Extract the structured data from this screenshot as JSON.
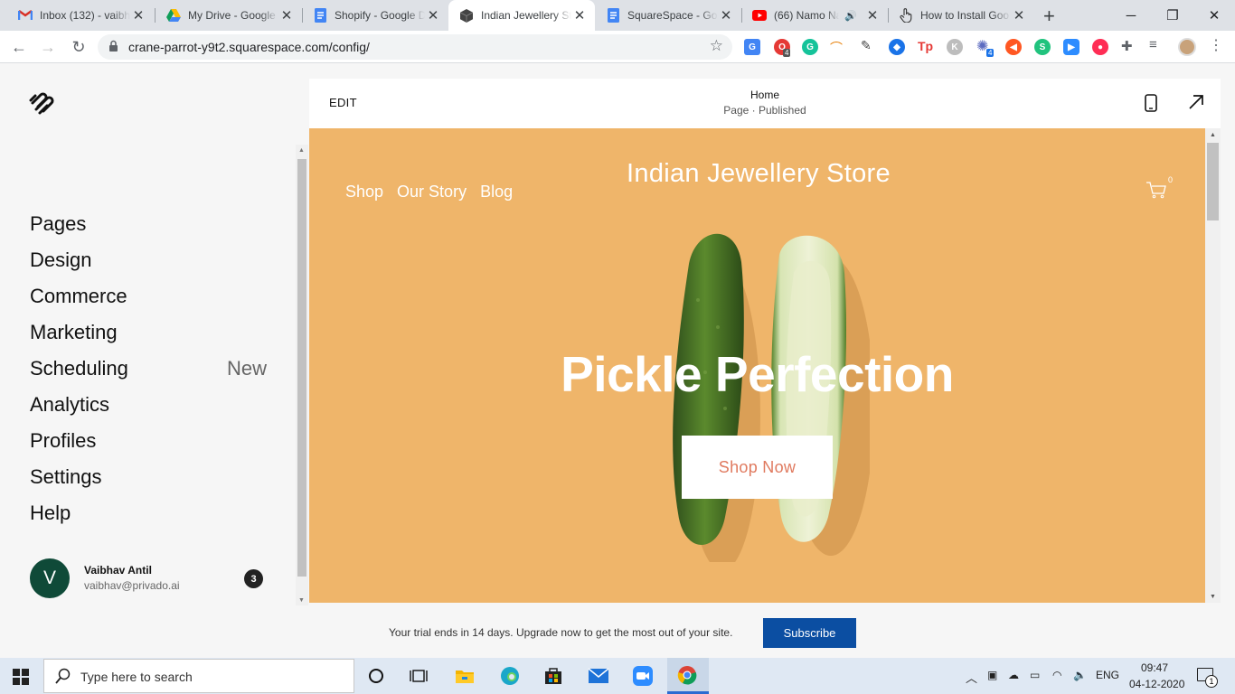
{
  "browser": {
    "tabs": [
      {
        "title": "Inbox (132) - vaibh",
        "icon": "gmail-icon",
        "color": "#d93025"
      },
      {
        "title": "My Drive - Google",
        "icon": "drive-icon",
        "color": "#1a73e8"
      },
      {
        "title": "Shopify - Google D",
        "icon": "docs-icon",
        "color": "#4285f4"
      },
      {
        "title": "Indian Jewellery St",
        "icon": "squarespace-cube-icon",
        "color": "#333333",
        "active": true
      },
      {
        "title": "SquareSpace - Goo",
        "icon": "docs-icon",
        "color": "#4285f4"
      },
      {
        "title": "(66) Namo Na",
        "icon": "youtube-icon",
        "color": "#ff0000"
      },
      {
        "title": "How to Install Goo",
        "icon": "hand-cursor-icon",
        "color": "#333333"
      }
    ],
    "url": "crane-parrot-y9t2.squarespace.com/config/",
    "ext_badges": {
      "opera": "4",
      "puzzle": "4"
    }
  },
  "sidebar": {
    "items": [
      {
        "label": "Pages"
      },
      {
        "label": "Design"
      },
      {
        "label": "Commerce"
      },
      {
        "label": "Marketing"
      },
      {
        "label": "Scheduling",
        "badge": "New"
      },
      {
        "label": "Analytics"
      },
      {
        "label": "Profiles"
      },
      {
        "label": "Settings"
      },
      {
        "label": "Help"
      }
    ],
    "user": {
      "initial": "V",
      "name": "Vaibhav Antil",
      "email": "vaibhav@privado.ai",
      "notifications": "3"
    }
  },
  "preview": {
    "edit_label": "EDIT",
    "page_title": "Home",
    "page_status": "Page · Published",
    "site": {
      "nav": [
        "Shop",
        "Our Story",
        "Blog"
      ],
      "title": "Indian Jewellery Store",
      "cart_count": "0",
      "headline": "Pickle Perfection",
      "cta": "Shop Now",
      "bg_color": "#efb56a",
      "cta_color": "#e07a5f"
    }
  },
  "trial": {
    "message": "Your trial ends in 14 days. Upgrade now to get the most out of your site.",
    "button": "Subscribe"
  },
  "taskbar": {
    "search_placeholder": "Type here to search",
    "language": "ENG",
    "time": "09:47",
    "date": "04-12-2020",
    "notification_count": "1"
  }
}
